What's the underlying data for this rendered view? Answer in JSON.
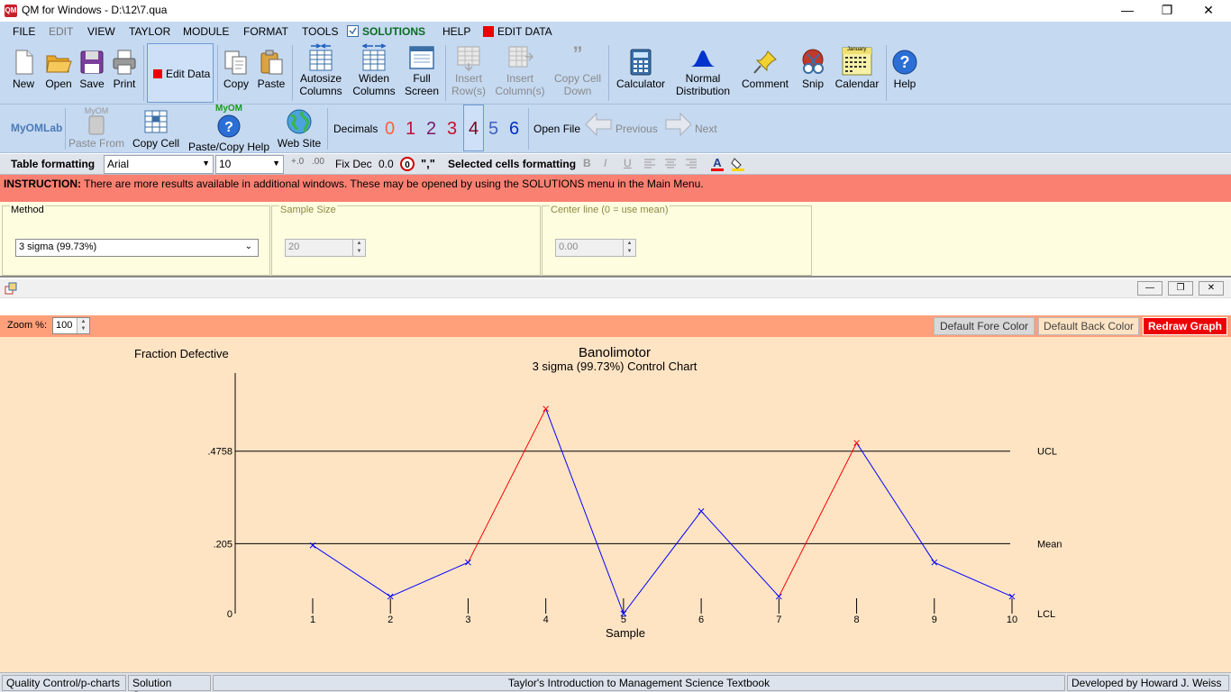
{
  "window": {
    "title": "QM for Windows - D:\\12\\7.qua",
    "app_icon_text": "QM"
  },
  "menu": {
    "items": [
      "FILE",
      "EDIT",
      "VIEW",
      "TAYLOR",
      "MODULE",
      "FORMAT",
      "TOOLS",
      "SOLUTIONS",
      "HELP",
      "EDIT DATA"
    ]
  },
  "toolbar1": {
    "new": "New",
    "open": "Open",
    "save": "Save",
    "print": "Print",
    "edit_data": "Edit Data",
    "copy": "Copy",
    "paste": "Paste",
    "autosize1": "Autosize",
    "autosize2": "Columns",
    "widen1": "Widen",
    "widen2": "Columns",
    "full1": "Full",
    "full2": "Screen",
    "insrow1": "Insert",
    "insrow2": "Row(s)",
    "inscol1": "Insert",
    "inscol2": "Column(s)",
    "copycell1": "Copy Cell",
    "copycell2": "Down",
    "calculator": "Calculator",
    "normal1": "Normal",
    "normal2": "Distribution",
    "comment": "Comment",
    "snip": "Snip",
    "calendar": "Calendar",
    "help": "Help",
    "calendar_header": "January"
  },
  "toolbar2": {
    "myomlab": "MyOMLab",
    "paste_from_top": "MyOM",
    "paste_from": "Paste From",
    "copy_cell": "Copy Cell",
    "paste_copy_help_top": "MyOM",
    "paste_copy_help": "Paste/Copy Help",
    "web_site": "Web Site",
    "decimals": "Decimals",
    "digits": [
      "0",
      "1",
      "2",
      "3",
      "4",
      "5",
      "6"
    ],
    "open_file": "Open File",
    "previous": "Previous",
    "next": "Next"
  },
  "format_bar": {
    "table_formatting": "Table formatting",
    "font": "Arial",
    "size": "10",
    "fix_dec": "Fix Dec",
    "zero": "0.0",
    "comma": "\",\"",
    "selected_cells": "Selected cells formatting"
  },
  "instruction": {
    "label": "INSTRUCTION:",
    "text": "There are more results available in additional windows. These may be opened by using the SOLUTIONS menu in the Main Menu."
  },
  "params": {
    "method_caption": "Method",
    "method_value": "3 sigma (99.73%)",
    "sample_caption": "Sample Size",
    "sample_value": "20",
    "center_caption": "Center line (0 = use mean)",
    "center_value": "0.00"
  },
  "chart_controls": {
    "zoom_label": "Zoom %:",
    "zoom_value": "100",
    "fore": "Default Fore Color",
    "back": "Default Back Color",
    "redraw": "Redraw Graph"
  },
  "status": {
    "module": "Quality Control/p-charts",
    "screen": "Solution Screen",
    "textbook": "Taylor's Introduction to Management Science Textbook",
    "developer": "Developed by Howard J. Weiss"
  },
  "colors": {
    "accent_bg": "#c5d9f1",
    "instruction_bg": "#fa8072",
    "chart_bg": "#ffe4c4",
    "in_control_line": "#0000ff",
    "out_of_control_line": "#ff0000"
  },
  "chart_data": {
    "type": "line",
    "title": "Banolimotor",
    "subtitle": "3 sigma (99.73%) Control Chart",
    "ylabel": "Fraction Defective",
    "xlabel": "Sample",
    "x": [
      1,
      2,
      3,
      4,
      5,
      6,
      7,
      8,
      9,
      10
    ],
    "values": [
      0.2,
      0.05,
      0.15,
      0.6,
      0.0,
      0.3,
      0.05,
      0.5,
      0.15,
      0.05
    ],
    "ylim": [
      0,
      0.71
    ],
    "ytick_labels": [
      {
        "value": 0,
        "label": "0"
      },
      {
        "value": 0.205,
        "label": ".205"
      },
      {
        "value": 0.4758,
        "label": ".4758"
      }
    ],
    "control_lines": [
      {
        "name": "UCL",
        "value": 0.4758
      },
      {
        "name": "Mean",
        "value": 0.205
      },
      {
        "name": "LCL",
        "value": 0
      }
    ],
    "grid": false
  }
}
